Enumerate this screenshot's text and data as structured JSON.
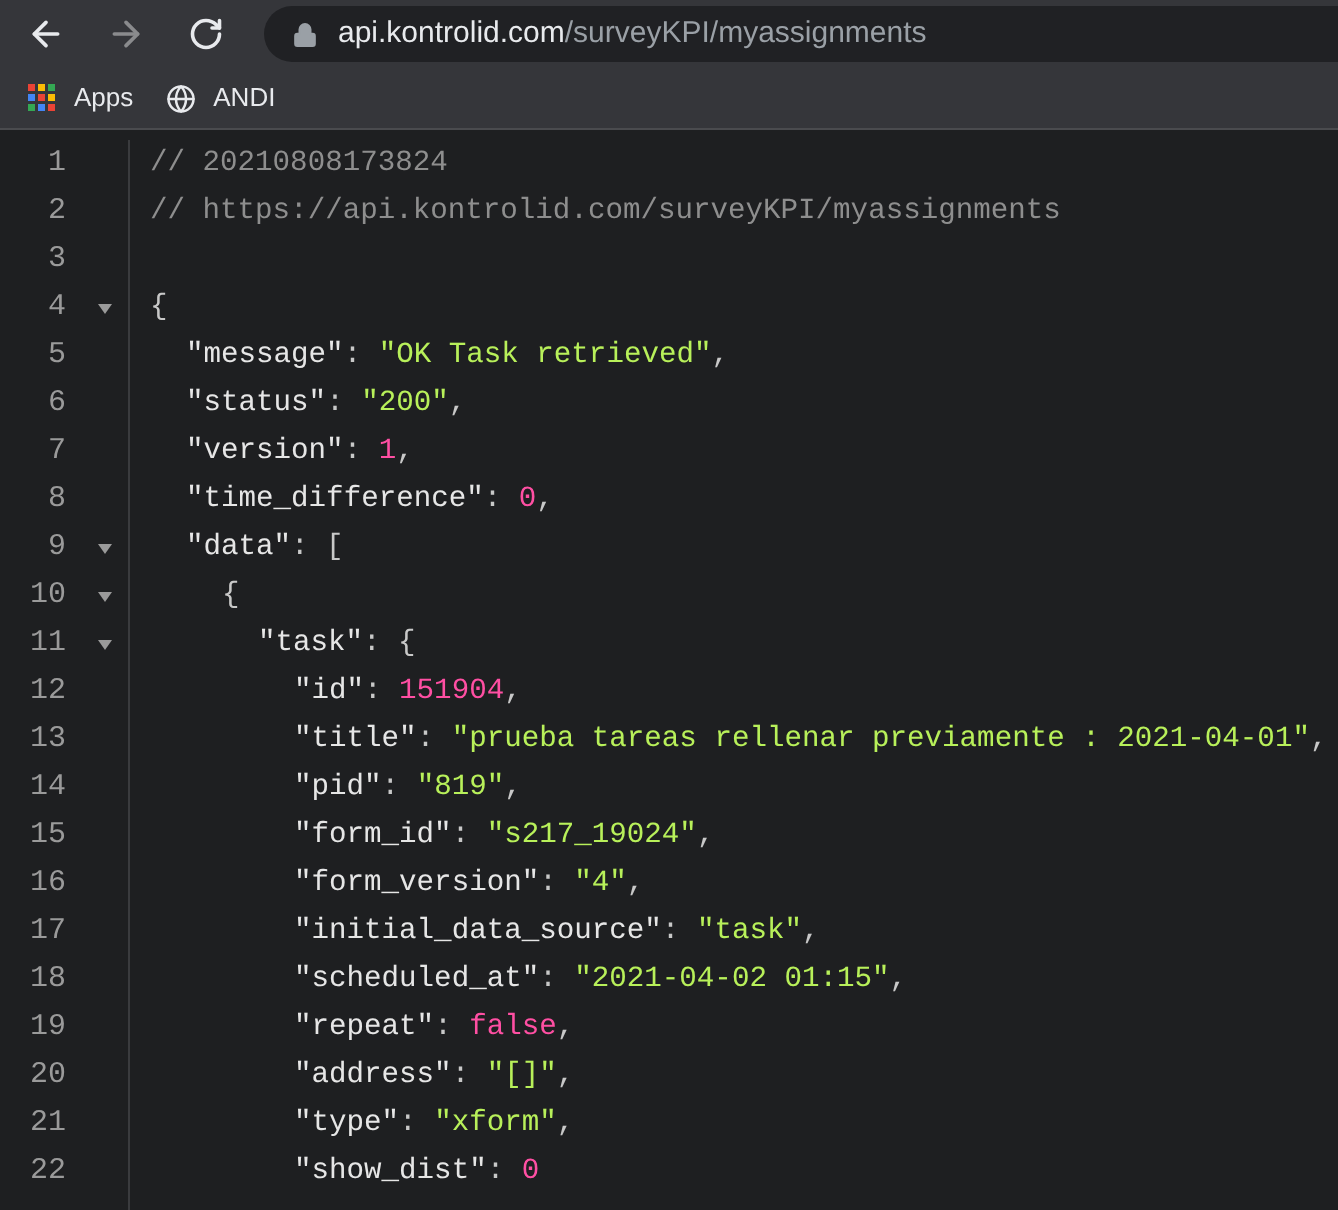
{
  "toolbar": {
    "buttons": [
      {
        "kind": "back",
        "disabled": false
      },
      {
        "kind": "forward",
        "disabled": true
      },
      {
        "kind": "reload",
        "disabled": false
      }
    ],
    "address_bar": {
      "host": "api.kontrolid.com",
      "path": "/surveyKPI/myassignments"
    }
  },
  "bookmarks": [
    {
      "kind": "apps",
      "label": "Apps"
    },
    {
      "kind": "site",
      "label": "ANDI"
    }
  ],
  "code_lines": [
    {
      "number": "1",
      "fold": false,
      "tokens": [
        {
          "kind": "comment",
          "text": "// 20210808173824"
        }
      ]
    },
    {
      "number": "2",
      "fold": false,
      "tokens": [
        {
          "kind": "comment",
          "text": "// https://api.kontrolid.com/surveyKPI/myassignments"
        }
      ]
    },
    {
      "number": "3",
      "fold": false
    },
    {
      "number": "4",
      "fold": true,
      "tokens": [
        {
          "kind": "punct",
          "text": "{"
        }
      ],
      "children": [
        {
          "number": "5",
          "fold": false,
          "tokens": [
            {
              "kind": "key",
              "text": "\"message\""
            },
            {
              "kind": "punct",
              "text": ": "
            },
            {
              "kind": "string",
              "text": "\"OK Task retrieved\""
            },
            {
              "kind": "punct",
              "text": ","
            }
          ]
        },
        {
          "number": "6",
          "fold": false,
          "tokens": [
            {
              "kind": "key",
              "text": "\"status\""
            },
            {
              "kind": "punct",
              "text": ": "
            },
            {
              "kind": "string",
              "text": "\"200\""
            },
            {
              "kind": "punct",
              "text": ","
            }
          ]
        },
        {
          "number": "7",
          "fold": false,
          "tokens": [
            {
              "kind": "key",
              "text": "\"version\""
            },
            {
              "kind": "punct",
              "text": ": "
            },
            {
              "kind": "number",
              "text": "1"
            },
            {
              "kind": "punct",
              "text": ","
            }
          ]
        },
        {
          "number": "8",
          "fold": false,
          "tokens": [
            {
              "kind": "key",
              "text": "\"time_difference\""
            },
            {
              "kind": "punct",
              "text": ": "
            },
            {
              "kind": "number",
              "text": "0"
            },
            {
              "kind": "punct",
              "text": ","
            }
          ]
        },
        {
          "number": "9",
          "fold": true,
          "tokens": [
            {
              "kind": "key",
              "text": "\"data\""
            },
            {
              "kind": "punct",
              "text": ": ["
            }
          ],
          "children": [
            {
              "number": "10",
              "fold": true,
              "tokens": [
                {
                  "kind": "punct",
                  "text": "{"
                }
              ],
              "children": [
                {
                  "number": "11",
                  "fold": true,
                  "tokens": [
                    {
                      "kind": "key",
                      "text": "\"task\""
                    },
                    {
                      "kind": "punct",
                      "text": ": {"
                    }
                  ],
                  "children": [
                    {
                      "number": "12",
                      "fold": false,
                      "tokens": [
                        {
                          "kind": "key",
                          "text": "\"id\""
                        },
                        {
                          "kind": "punct",
                          "text": ": "
                        },
                        {
                          "kind": "number",
                          "text": "151904"
                        },
                        {
                          "kind": "punct",
                          "text": ","
                        }
                      ]
                    },
                    {
                      "number": "13",
                      "fold": false,
                      "tokens": [
                        {
                          "kind": "key",
                          "text": "\"title\""
                        },
                        {
                          "kind": "punct",
                          "text": ": "
                        },
                        {
                          "kind": "string",
                          "text": "\"prueba tareas rellenar previamente : 2021-04-01\""
                        },
                        {
                          "kind": "punct",
                          "text": ","
                        }
                      ]
                    },
                    {
                      "number": "14",
                      "fold": false,
                      "tokens": [
                        {
                          "kind": "key",
                          "text": "\"pid\""
                        },
                        {
                          "kind": "punct",
                          "text": ": "
                        },
                        {
                          "kind": "string",
                          "text": "\"819\""
                        },
                        {
                          "kind": "punct",
                          "text": ","
                        }
                      ]
                    },
                    {
                      "number": "15",
                      "fold": false,
                      "tokens": [
                        {
                          "kind": "key",
                          "text": "\"form_id\""
                        },
                        {
                          "kind": "punct",
                          "text": ": "
                        },
                        {
                          "kind": "string",
                          "text": "\"s217_19024\""
                        },
                        {
                          "kind": "punct",
                          "text": ","
                        }
                      ]
                    },
                    {
                      "number": "16",
                      "fold": false,
                      "tokens": [
                        {
                          "kind": "key",
                          "text": "\"form_version\""
                        },
                        {
                          "kind": "punct",
                          "text": ": "
                        },
                        {
                          "kind": "string",
                          "text": "\"4\""
                        },
                        {
                          "kind": "punct",
                          "text": ","
                        }
                      ]
                    },
                    {
                      "number": "17",
                      "fold": false,
                      "tokens": [
                        {
                          "kind": "key",
                          "text": "\"initial_data_source\""
                        },
                        {
                          "kind": "punct",
                          "text": ": "
                        },
                        {
                          "kind": "string",
                          "text": "\"task\""
                        },
                        {
                          "kind": "punct",
                          "text": ","
                        }
                      ]
                    },
                    {
                      "number": "18",
                      "fold": false,
                      "tokens": [
                        {
                          "kind": "key",
                          "text": "\"scheduled_at\""
                        },
                        {
                          "kind": "punct",
                          "text": ": "
                        },
                        {
                          "kind": "string",
                          "text": "\"2021-04-02 01:15\""
                        },
                        {
                          "kind": "punct",
                          "text": ","
                        }
                      ]
                    },
                    {
                      "number": "19",
                      "fold": false,
                      "tokens": [
                        {
                          "kind": "key",
                          "text": "\"repeat\""
                        },
                        {
                          "kind": "punct",
                          "text": ": "
                        },
                        {
                          "kind": "keyword",
                          "text": "false"
                        },
                        {
                          "kind": "punct",
                          "text": ","
                        }
                      ]
                    },
                    {
                      "number": "20",
                      "fold": false,
                      "tokens": [
                        {
                          "kind": "key",
                          "text": "\"address\""
                        },
                        {
                          "kind": "punct",
                          "text": ": "
                        },
                        {
                          "kind": "string",
                          "text": "\"[]\""
                        },
                        {
                          "kind": "punct",
                          "text": ","
                        }
                      ]
                    },
                    {
                      "number": "21",
                      "fold": false,
                      "tokens": [
                        {
                          "kind": "key",
                          "text": "\"type\""
                        },
                        {
                          "kind": "punct",
                          "text": ": "
                        },
                        {
                          "kind": "string",
                          "text": "\"xform\""
                        },
                        {
                          "kind": "punct",
                          "text": ","
                        }
                      ]
                    },
                    {
                      "number": "22",
                      "fold": false,
                      "tokens": [
                        {
                          "kind": "key",
                          "text": "\"show_dist\""
                        },
                        {
                          "kind": "punct",
                          "text": ": "
                        },
                        {
                          "kind": "number",
                          "text": "0"
                        }
                      ]
                    }
                  ]
                }
              ]
            }
          ]
        }
      ]
    }
  ]
}
